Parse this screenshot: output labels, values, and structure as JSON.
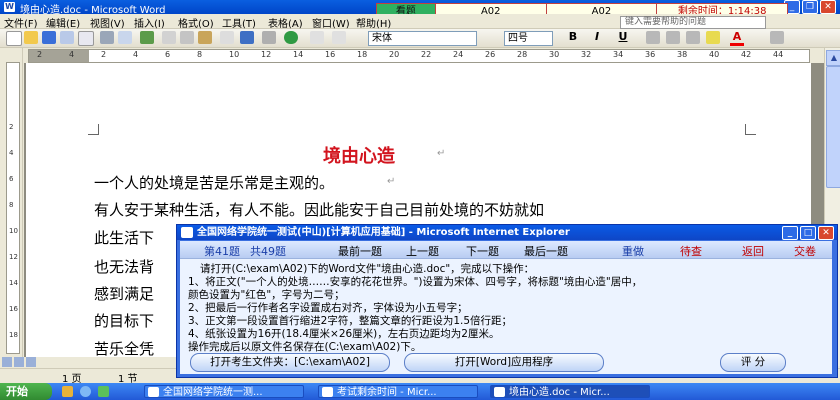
{
  "word": {
    "title": "境由心造.doc - Microsoft Word",
    "menus": [
      "文件(F)",
      "编辑(E)",
      "视图(V)",
      "插入(I)",
      "格式(O)",
      "工具(T)",
      "表格(A)",
      "窗口(W)",
      "帮助(H)"
    ],
    "help_placeholder": "键入需要帮助的问题",
    "font_name": "宋体",
    "font_size": "四号",
    "bold_label": "B",
    "italic_label": "I",
    "underline_label": "U",
    "font_color_label": "A",
    "ruler_marks": [
      "2",
      "4",
      "2",
      "4",
      "6",
      "8",
      "10",
      "12",
      "14",
      "16",
      "18",
      "20",
      "22",
      "24",
      "26",
      "28",
      "30",
      "32",
      "34",
      "36",
      "38",
      "40",
      "42",
      "44"
    ],
    "vruler_marks": [
      "2",
      "4",
      "6",
      "8",
      "10",
      "12",
      "14",
      "16",
      "18"
    ],
    "doc_title": "境由心造",
    "paragraphs": [
      "一个人的处境是苦是乐常是主观的。",
      "有人安于某种生活，有人不能。因此能安于自己目前处境的不妨就如",
      "此生活下",
      "也无法背",
      "感到满足",
      "的目标下",
      "苦乐全凭"
    ],
    "status": {
      "page": "1 页",
      "section": "1 节"
    }
  },
  "exam_bar": {
    "label": "看题",
    "cell1": "A02",
    "cell2": "A02",
    "time": "剩余时间：1:14:38"
  },
  "popup": {
    "title": "全国网络学院统一测试(中山)[计算机应用基础] - Microsoft Internet Explorer",
    "q_current": "第41题",
    "q_total": "共49题",
    "nav": [
      "最前一题",
      "上一题",
      "下一题",
      "最后一题"
    ],
    "actions": [
      "重做",
      "待查",
      "返回",
      "交卷"
    ],
    "instructions": [
      "请打开(C:\\exam\\A02)下的Word文件\"境由心造.doc\"，完成以下操作：",
      "1、将正文(\"一个人的处境……安享的花花世界。\")设置为宋体、四号字，将标题\"境由心造\"居中，",
      "颜色设置为\"红色\"，字号为二号；",
      "2、把最后一行作者名字设置成右对齐，字体设为小五号字；",
      "3、正文第一段设置首行缩进2字符，整篇文章的行距设为1.5倍行距；",
      "4、纸张设置为16开(18.4厘米×26厘米)，左右页边距均为2厘米。",
      "操作完成后以原文件名保存在(C:\\exam\\A02)下。"
    ],
    "btn_open_folder": "打开考生文件夹：[C:\\exam\\A02]",
    "btn_open_word": "打开[Word]应用程序",
    "btn_score": "评 分"
  },
  "taskbar": {
    "start": "开始",
    "tasks": [
      "全国网络学院统一测...",
      "考试剩余时间 - Micr...",
      "境由心造.doc - Micr..."
    ]
  },
  "colors": {
    "title_red": "#D2141E",
    "xp_blue": "#0A5FE0",
    "timer_red": "#C00000"
  }
}
